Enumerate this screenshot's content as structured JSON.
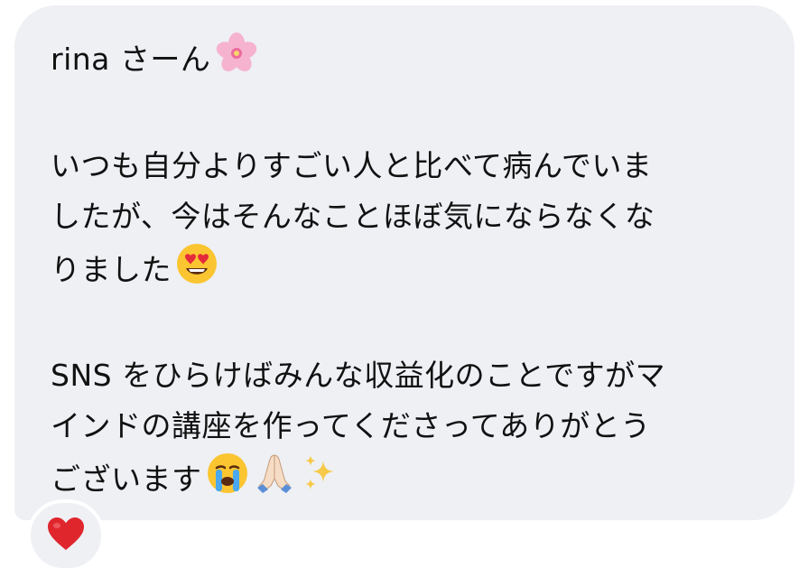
{
  "message": {
    "greeting": "rina さーん",
    "greeting_emoji": "cherry-blossom-icon",
    "para1_line1": "いつも自分よりすごい人と比べて病んでいま",
    "para1_line2": "したが、今はそんなことほぼ気にならなくな",
    "para1_line3": "りました",
    "para1_emoji": "heart-eyes-face-icon",
    "para2_line1": "SNS をひらけばみんな収益化のことですがマ",
    "para2_line2": "インドの講座を作ってくださってありがとう",
    "para2_line3": "ございます",
    "para2_emojis": [
      "loudly-crying-face-icon",
      "folded-hands-icon",
      "sparkles-icon"
    ]
  },
  "reaction": {
    "emoji": "red-heart-icon",
    "color": "#e0262d"
  },
  "colors": {
    "bubble": "#eef0f4",
    "text": "#111111"
  }
}
